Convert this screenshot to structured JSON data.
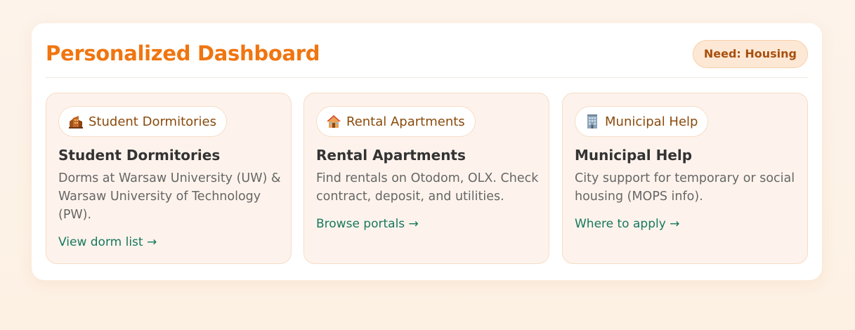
{
  "header": {
    "title": "Personalized Dashboard",
    "badge": "Need: Housing"
  },
  "cards": [
    {
      "chip_label": "Student Dormitories",
      "icon": "dormitory-icon",
      "title": "Student Dormitories",
      "description": "Dorms at Warsaw University (UW) & Warsaw University of Technology (PW).",
      "link": "View dorm list →"
    },
    {
      "chip_label": "Rental Apartments",
      "icon": "house-icon",
      "title": "Rental Apartments",
      "description": "Find rentals on Otodom, OLX. Check contract, deposit, and utilities.",
      "link": "Browse portals →"
    },
    {
      "chip_label": "Municipal Help",
      "icon": "office-building-icon",
      "title": "Municipal Help",
      "description": "City support for temporary or social housing (MOPS info).",
      "link": "Where to apply →"
    }
  ],
  "colors": {
    "accent": "#f0750f",
    "badge_text": "#a8500f",
    "card_bg": "#fdf3ec",
    "link": "#17775e"
  }
}
